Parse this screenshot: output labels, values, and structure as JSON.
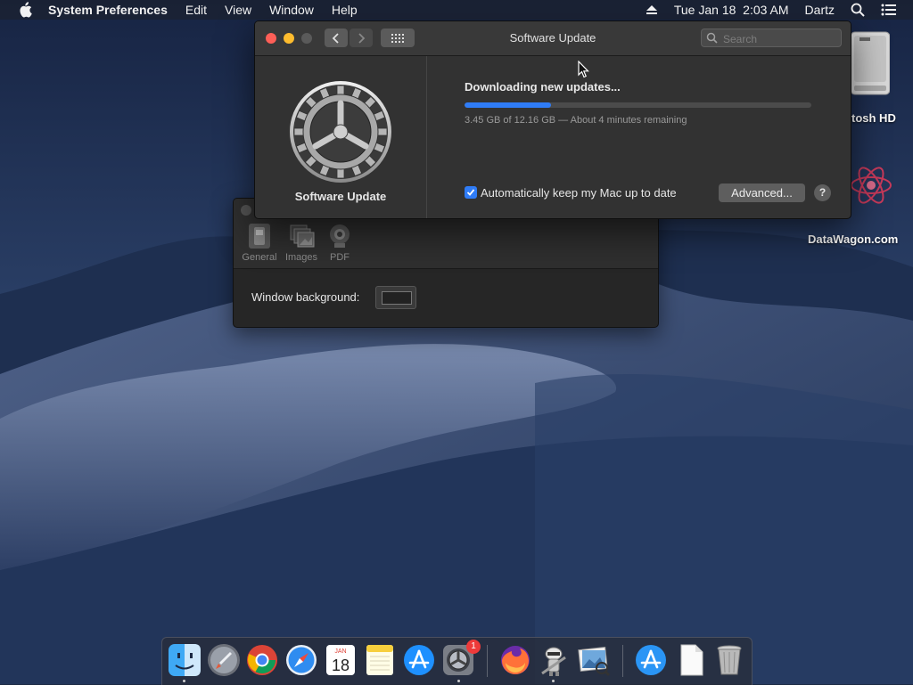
{
  "menubar": {
    "app_name": "System Preferences",
    "menus": [
      "Edit",
      "View",
      "Window",
      "Help"
    ],
    "datetime": "Tue Jan 18  2:03 AM",
    "user": "Dartz"
  },
  "desktop": {
    "hd_label_partial": "tosh HD",
    "watermark": "DataWagon.com"
  },
  "prefs_window": {
    "tabs": [
      {
        "label": "General",
        "icon": "switch-icon"
      },
      {
        "label": "Images",
        "icon": "images-icon"
      },
      {
        "label": "PDF",
        "icon": "pdf-icon"
      }
    ],
    "background_label": "Window background:"
  },
  "software_update": {
    "window_title": "Software Update",
    "search_placeholder": "Search",
    "pane_name": "Software Update",
    "status": "Downloading new updates...",
    "progress_fraction": 0.25,
    "detail": "3.45 GB of 12.16 GB — About 4 minutes remaining",
    "auto_update_label": "Automatically keep my Mac up to date",
    "auto_update_checked": true,
    "advanced_button": "Advanced...",
    "help_button": "?",
    "accent_color": "#2f7cf6"
  },
  "dock": {
    "items": [
      "finder",
      "launchpad",
      "chrome",
      "safari",
      "calendar",
      "notes",
      "app-store",
      "system-preferences",
      "firefox",
      "automator",
      "preview",
      "downloads",
      "documents",
      "trash"
    ],
    "calendar_month": "JAN",
    "calendar_day": "18",
    "system_prefs_badge": "1"
  }
}
